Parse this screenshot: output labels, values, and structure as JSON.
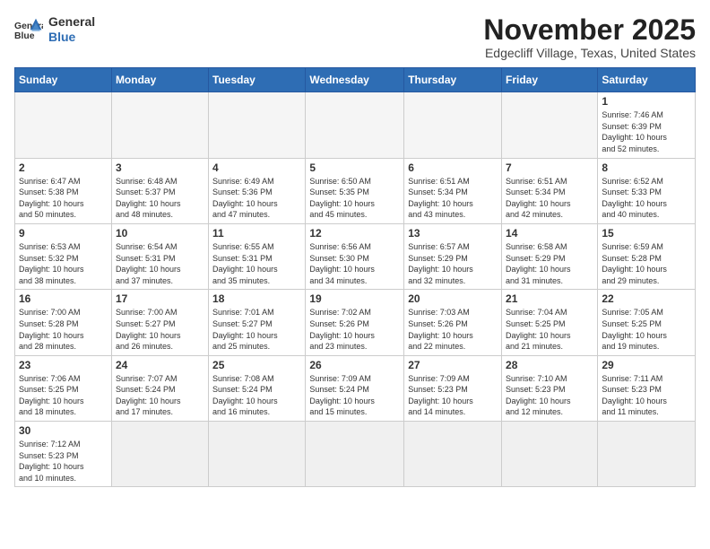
{
  "logo": {
    "line1": "General",
    "line2": "Blue"
  },
  "title": "November 2025",
  "location": "Edgecliff Village, Texas, United States",
  "days_of_week": [
    "Sunday",
    "Monday",
    "Tuesday",
    "Wednesday",
    "Thursday",
    "Friday",
    "Saturday"
  ],
  "weeks": [
    [
      {
        "day": null,
        "info": null
      },
      {
        "day": null,
        "info": null
      },
      {
        "day": null,
        "info": null
      },
      {
        "day": null,
        "info": null
      },
      {
        "day": null,
        "info": null
      },
      {
        "day": null,
        "info": null
      },
      {
        "day": "1",
        "info": "Sunrise: 7:46 AM\nSunset: 6:39 PM\nDaylight: 10 hours\nand 52 minutes."
      }
    ],
    [
      {
        "day": "2",
        "info": "Sunrise: 6:47 AM\nSunset: 5:38 PM\nDaylight: 10 hours\nand 50 minutes."
      },
      {
        "day": "3",
        "info": "Sunrise: 6:48 AM\nSunset: 5:37 PM\nDaylight: 10 hours\nand 48 minutes."
      },
      {
        "day": "4",
        "info": "Sunrise: 6:49 AM\nSunset: 5:36 PM\nDaylight: 10 hours\nand 47 minutes."
      },
      {
        "day": "5",
        "info": "Sunrise: 6:50 AM\nSunset: 5:35 PM\nDaylight: 10 hours\nand 45 minutes."
      },
      {
        "day": "6",
        "info": "Sunrise: 6:51 AM\nSunset: 5:34 PM\nDaylight: 10 hours\nand 43 minutes."
      },
      {
        "day": "7",
        "info": "Sunrise: 6:51 AM\nSunset: 5:34 PM\nDaylight: 10 hours\nand 42 minutes."
      },
      {
        "day": "8",
        "info": "Sunrise: 6:52 AM\nSunset: 5:33 PM\nDaylight: 10 hours\nand 40 minutes."
      }
    ],
    [
      {
        "day": "9",
        "info": "Sunrise: 6:53 AM\nSunset: 5:32 PM\nDaylight: 10 hours\nand 38 minutes."
      },
      {
        "day": "10",
        "info": "Sunrise: 6:54 AM\nSunset: 5:31 PM\nDaylight: 10 hours\nand 37 minutes."
      },
      {
        "day": "11",
        "info": "Sunrise: 6:55 AM\nSunset: 5:31 PM\nDaylight: 10 hours\nand 35 minutes."
      },
      {
        "day": "12",
        "info": "Sunrise: 6:56 AM\nSunset: 5:30 PM\nDaylight: 10 hours\nand 34 minutes."
      },
      {
        "day": "13",
        "info": "Sunrise: 6:57 AM\nSunset: 5:29 PM\nDaylight: 10 hours\nand 32 minutes."
      },
      {
        "day": "14",
        "info": "Sunrise: 6:58 AM\nSunset: 5:29 PM\nDaylight: 10 hours\nand 31 minutes."
      },
      {
        "day": "15",
        "info": "Sunrise: 6:59 AM\nSunset: 5:28 PM\nDaylight: 10 hours\nand 29 minutes."
      }
    ],
    [
      {
        "day": "16",
        "info": "Sunrise: 7:00 AM\nSunset: 5:28 PM\nDaylight: 10 hours\nand 28 minutes."
      },
      {
        "day": "17",
        "info": "Sunrise: 7:00 AM\nSunset: 5:27 PM\nDaylight: 10 hours\nand 26 minutes."
      },
      {
        "day": "18",
        "info": "Sunrise: 7:01 AM\nSunset: 5:27 PM\nDaylight: 10 hours\nand 25 minutes."
      },
      {
        "day": "19",
        "info": "Sunrise: 7:02 AM\nSunset: 5:26 PM\nDaylight: 10 hours\nand 23 minutes."
      },
      {
        "day": "20",
        "info": "Sunrise: 7:03 AM\nSunset: 5:26 PM\nDaylight: 10 hours\nand 22 minutes."
      },
      {
        "day": "21",
        "info": "Sunrise: 7:04 AM\nSunset: 5:25 PM\nDaylight: 10 hours\nand 21 minutes."
      },
      {
        "day": "22",
        "info": "Sunrise: 7:05 AM\nSunset: 5:25 PM\nDaylight: 10 hours\nand 19 minutes."
      }
    ],
    [
      {
        "day": "23",
        "info": "Sunrise: 7:06 AM\nSunset: 5:25 PM\nDaylight: 10 hours\nand 18 minutes."
      },
      {
        "day": "24",
        "info": "Sunrise: 7:07 AM\nSunset: 5:24 PM\nDaylight: 10 hours\nand 17 minutes."
      },
      {
        "day": "25",
        "info": "Sunrise: 7:08 AM\nSunset: 5:24 PM\nDaylight: 10 hours\nand 16 minutes."
      },
      {
        "day": "26",
        "info": "Sunrise: 7:09 AM\nSunset: 5:24 PM\nDaylight: 10 hours\nand 15 minutes."
      },
      {
        "day": "27",
        "info": "Sunrise: 7:09 AM\nSunset: 5:23 PM\nDaylight: 10 hours\nand 14 minutes."
      },
      {
        "day": "28",
        "info": "Sunrise: 7:10 AM\nSunset: 5:23 PM\nDaylight: 10 hours\nand 12 minutes."
      },
      {
        "day": "29",
        "info": "Sunrise: 7:11 AM\nSunset: 5:23 PM\nDaylight: 10 hours\nand 11 minutes."
      }
    ],
    [
      {
        "day": "30",
        "info": "Sunrise: 7:12 AM\nSunset: 5:23 PM\nDaylight: 10 hours\nand 10 minutes."
      },
      {
        "day": null,
        "info": null
      },
      {
        "day": null,
        "info": null
      },
      {
        "day": null,
        "info": null
      },
      {
        "day": null,
        "info": null
      },
      {
        "day": null,
        "info": null
      },
      {
        "day": null,
        "info": null
      }
    ]
  ]
}
